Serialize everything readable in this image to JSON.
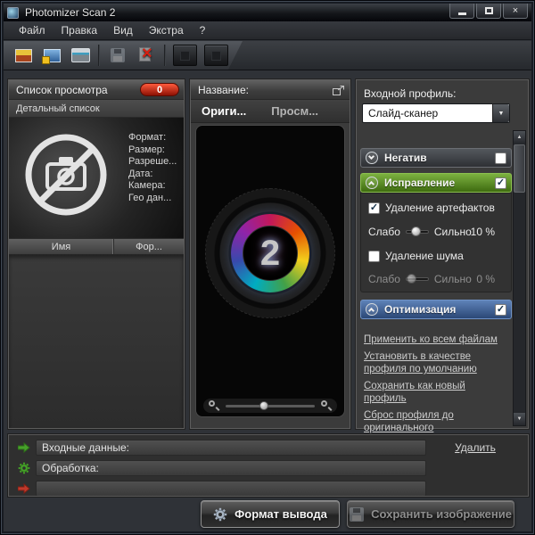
{
  "window": {
    "title": "Photomizer Scan 2"
  },
  "icons": {
    "check": "✓",
    "close": "×",
    "delete_cross": "×",
    "dropdown_arrow": "▼",
    "scroll_up": "▲",
    "scroll_down": "▼"
  },
  "menu": {
    "file": "Файл",
    "edit": "Правка",
    "view": "Вид",
    "extra": "Экстра",
    "help": "?"
  },
  "left_panel": {
    "header": "Список просмотра",
    "count": "0",
    "view_mode": "Детальный список",
    "meta": [
      "Формат:",
      "Размер:",
      "Разреше...",
      "Дата:",
      "Камера:",
      "Гео дан..."
    ],
    "columns": [
      "Имя",
      "Фор..."
    ]
  },
  "center_panel": {
    "header": "Название:",
    "tab_original": "Ориги...",
    "tab_preview": "Просм...",
    "lens_number": "2"
  },
  "right_panel": {
    "profile_label": "Входной профиль:",
    "profile_value": "Слайд-сканер",
    "section_negative": "Негатив",
    "section_correction": "Исправление",
    "section_optimization": "Оптимизация",
    "artifact_removal": "Удаление артефактов",
    "noise_removal": "Удаление шума",
    "weak": "Слабо",
    "strong": "Сильно",
    "artifact_value": "10 %",
    "noise_value": "0 %",
    "links": [
      "Применить ко всем файлам",
      "Установить в качестве профиля по умолчанию",
      "Сохранить как новый профиль",
      "Сброс профиля до оригинального"
    ]
  },
  "status_panel": {
    "input_label": "Входные данные:",
    "delete_link": "Удалить",
    "processing_label": "Обработка:"
  },
  "footer": {
    "output_format": "Формат вывода",
    "save_image": "Сохранить изображение"
  },
  "colors": {
    "correction_header": "#4f8a1d",
    "optimization_header": "#35517f",
    "badge": "#c0170b"
  }
}
